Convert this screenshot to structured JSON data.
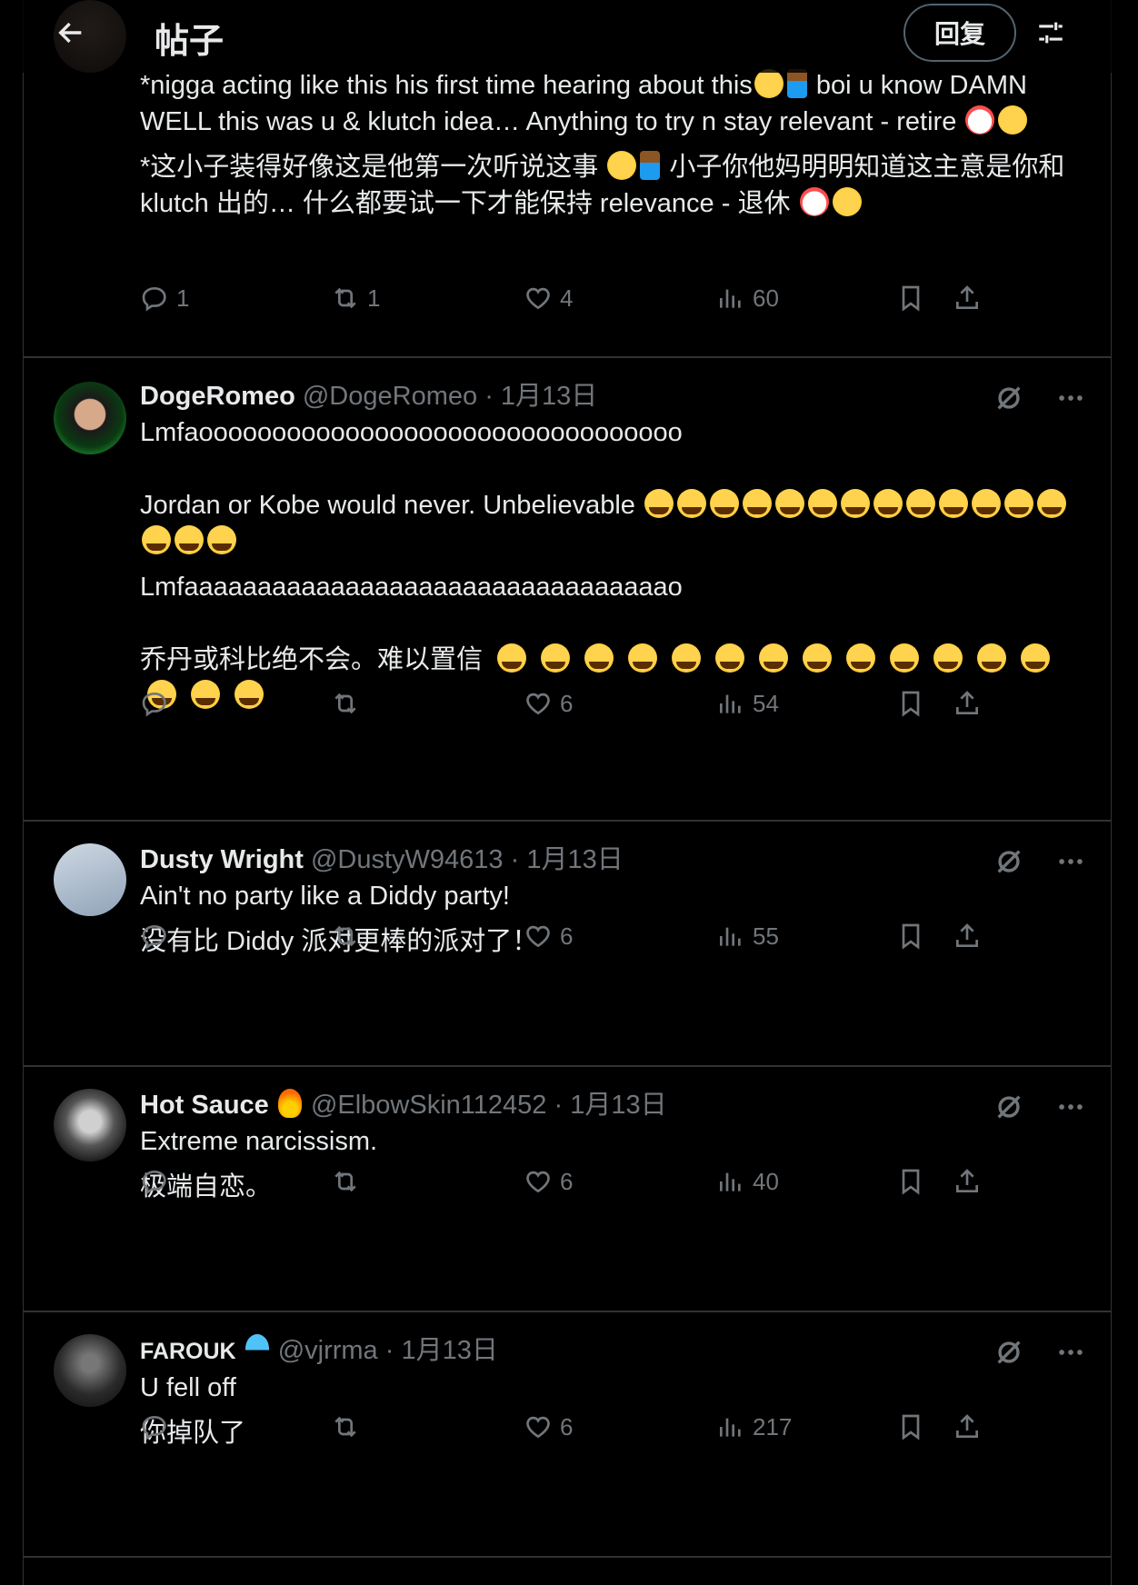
{
  "header": {
    "title": "帖子",
    "reply_label": "回复"
  },
  "posts": [
    {
      "text_parts": [
        "*nigga acting like this his first time hearing about this",
        " boi u know DAMN WELL this was u & klutch idea… Anything to try n stay relevant - retire "
      ],
      "translation_parts": [
        "*这小子装得好像这是他第一次听说这事 ",
        " 小子你他妈明明知道这主意是你和 klutch 出的… 什么都要试一下才能保持 relevance - 退休 "
      ],
      "replies": "1",
      "reposts": "1",
      "likes": "4",
      "views": "60"
    },
    {
      "name": "DogeRomeo",
      "handle": "@DogeRomeo",
      "date": "1月13日",
      "text": "Lmfaooooooooooooooooooooooooooooooooo\n\nJordan or Kobe would never. Unbelievable ",
      "translation": "Lmfaaaaaaaaaaaaaaaaaaaaaaaaaaaaaaaaao\n\n乔丹或科比绝不会。难以置信 ",
      "replies": "",
      "reposts": "",
      "likes": "6",
      "views": "54"
    },
    {
      "name": "Dusty Wright",
      "handle": "@DustyW94613",
      "date": "1月13日",
      "text": "Ain't no party like a Diddy party!",
      "translation": "没有比 Diddy 派对更棒的派对了！",
      "replies": "",
      "reposts": "",
      "likes": "6",
      "views": "55"
    },
    {
      "name": "Hot Sauce",
      "handle": "@ElbowSkin112452",
      "date": "1月13日",
      "text": "Extreme narcissism.",
      "translation": "极端自恋。",
      "replies": "",
      "reposts": "",
      "likes": "6",
      "views": "40"
    },
    {
      "name": "FAROUK",
      "handle": "@vjrrma",
      "date": "1月13日",
      "text": "U fell off",
      "translation": "你掉队了",
      "replies": "",
      "reposts": "",
      "likes": "6",
      "views": "217"
    }
  ],
  "separator": "·",
  "icons": {
    "back": "arrow-left-icon",
    "filter": "sliders-icon",
    "grok": "grok-icon",
    "more": "more-icon",
    "reply": "reply-icon",
    "repost": "repost-icon",
    "like": "heart-icon",
    "views": "views-icon",
    "bookmark": "bookmark-icon",
    "share": "share-icon"
  },
  "colors": {
    "background": "#000000",
    "text": "#e7e9ea",
    "muted": "#71767b",
    "border": "#2f3336"
  }
}
